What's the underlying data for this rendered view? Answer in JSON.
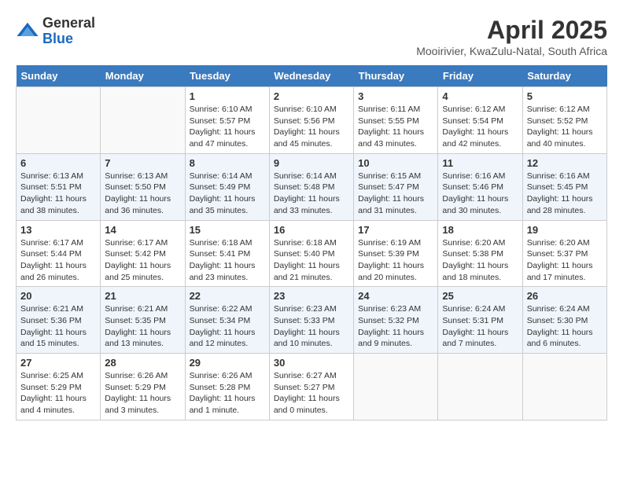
{
  "logo": {
    "general": "General",
    "blue": "Blue"
  },
  "title": "April 2025",
  "subtitle": "Mooirivier, KwaZulu-Natal, South Africa",
  "days_header": [
    "Sunday",
    "Monday",
    "Tuesday",
    "Wednesday",
    "Thursday",
    "Friday",
    "Saturday"
  ],
  "weeks": [
    [
      {
        "day": "",
        "info": ""
      },
      {
        "day": "",
        "info": ""
      },
      {
        "day": "1",
        "info": "Sunrise: 6:10 AM\nSunset: 5:57 PM\nDaylight: 11 hours and 47 minutes."
      },
      {
        "day": "2",
        "info": "Sunrise: 6:10 AM\nSunset: 5:56 PM\nDaylight: 11 hours and 45 minutes."
      },
      {
        "day": "3",
        "info": "Sunrise: 6:11 AM\nSunset: 5:55 PM\nDaylight: 11 hours and 43 minutes."
      },
      {
        "day": "4",
        "info": "Sunrise: 6:12 AM\nSunset: 5:54 PM\nDaylight: 11 hours and 42 minutes."
      },
      {
        "day": "5",
        "info": "Sunrise: 6:12 AM\nSunset: 5:52 PM\nDaylight: 11 hours and 40 minutes."
      }
    ],
    [
      {
        "day": "6",
        "info": "Sunrise: 6:13 AM\nSunset: 5:51 PM\nDaylight: 11 hours and 38 minutes."
      },
      {
        "day": "7",
        "info": "Sunrise: 6:13 AM\nSunset: 5:50 PM\nDaylight: 11 hours and 36 minutes."
      },
      {
        "day": "8",
        "info": "Sunrise: 6:14 AM\nSunset: 5:49 PM\nDaylight: 11 hours and 35 minutes."
      },
      {
        "day": "9",
        "info": "Sunrise: 6:14 AM\nSunset: 5:48 PM\nDaylight: 11 hours and 33 minutes."
      },
      {
        "day": "10",
        "info": "Sunrise: 6:15 AM\nSunset: 5:47 PM\nDaylight: 11 hours and 31 minutes."
      },
      {
        "day": "11",
        "info": "Sunrise: 6:16 AM\nSunset: 5:46 PM\nDaylight: 11 hours and 30 minutes."
      },
      {
        "day": "12",
        "info": "Sunrise: 6:16 AM\nSunset: 5:45 PM\nDaylight: 11 hours and 28 minutes."
      }
    ],
    [
      {
        "day": "13",
        "info": "Sunrise: 6:17 AM\nSunset: 5:44 PM\nDaylight: 11 hours and 26 minutes."
      },
      {
        "day": "14",
        "info": "Sunrise: 6:17 AM\nSunset: 5:42 PM\nDaylight: 11 hours and 25 minutes."
      },
      {
        "day": "15",
        "info": "Sunrise: 6:18 AM\nSunset: 5:41 PM\nDaylight: 11 hours and 23 minutes."
      },
      {
        "day": "16",
        "info": "Sunrise: 6:18 AM\nSunset: 5:40 PM\nDaylight: 11 hours and 21 minutes."
      },
      {
        "day": "17",
        "info": "Sunrise: 6:19 AM\nSunset: 5:39 PM\nDaylight: 11 hours and 20 minutes."
      },
      {
        "day": "18",
        "info": "Sunrise: 6:20 AM\nSunset: 5:38 PM\nDaylight: 11 hours and 18 minutes."
      },
      {
        "day": "19",
        "info": "Sunrise: 6:20 AM\nSunset: 5:37 PM\nDaylight: 11 hours and 17 minutes."
      }
    ],
    [
      {
        "day": "20",
        "info": "Sunrise: 6:21 AM\nSunset: 5:36 PM\nDaylight: 11 hours and 15 minutes."
      },
      {
        "day": "21",
        "info": "Sunrise: 6:21 AM\nSunset: 5:35 PM\nDaylight: 11 hours and 13 minutes."
      },
      {
        "day": "22",
        "info": "Sunrise: 6:22 AM\nSunset: 5:34 PM\nDaylight: 11 hours and 12 minutes."
      },
      {
        "day": "23",
        "info": "Sunrise: 6:23 AM\nSunset: 5:33 PM\nDaylight: 11 hours and 10 minutes."
      },
      {
        "day": "24",
        "info": "Sunrise: 6:23 AM\nSunset: 5:32 PM\nDaylight: 11 hours and 9 minutes."
      },
      {
        "day": "25",
        "info": "Sunrise: 6:24 AM\nSunset: 5:31 PM\nDaylight: 11 hours and 7 minutes."
      },
      {
        "day": "26",
        "info": "Sunrise: 6:24 AM\nSunset: 5:30 PM\nDaylight: 11 hours and 6 minutes."
      }
    ],
    [
      {
        "day": "27",
        "info": "Sunrise: 6:25 AM\nSunset: 5:29 PM\nDaylight: 11 hours and 4 minutes."
      },
      {
        "day": "28",
        "info": "Sunrise: 6:26 AM\nSunset: 5:29 PM\nDaylight: 11 hours and 3 minutes."
      },
      {
        "day": "29",
        "info": "Sunrise: 6:26 AM\nSunset: 5:28 PM\nDaylight: 11 hours and 1 minute."
      },
      {
        "day": "30",
        "info": "Sunrise: 6:27 AM\nSunset: 5:27 PM\nDaylight: 11 hours and 0 minutes."
      },
      {
        "day": "",
        "info": ""
      },
      {
        "day": "",
        "info": ""
      },
      {
        "day": "",
        "info": ""
      }
    ]
  ]
}
